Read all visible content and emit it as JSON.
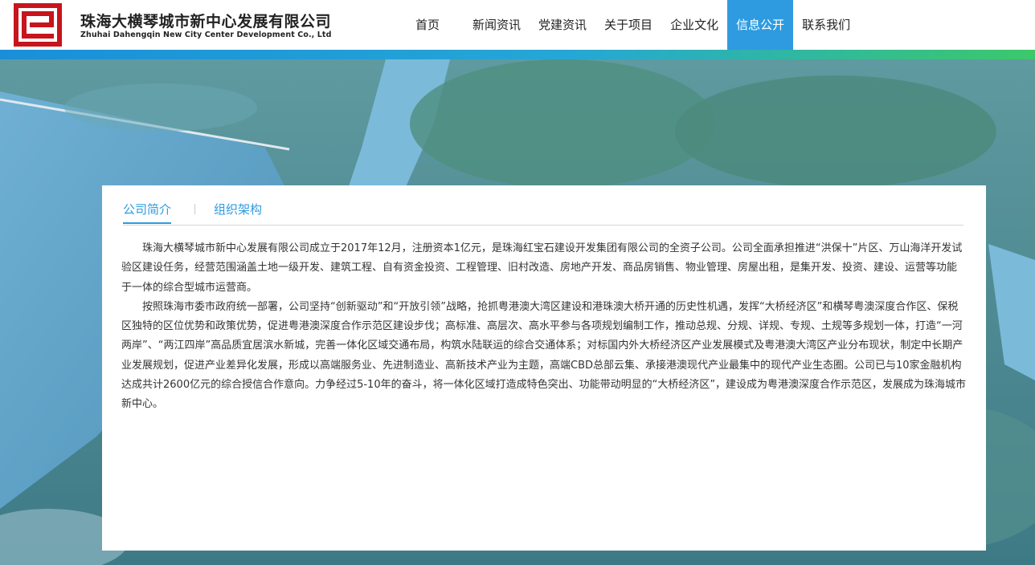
{
  "company": {
    "name_cn": "珠海大横琴城市新中心发展有限公司",
    "name_en": "Zhuhai Dahengqin New City Center Development Co., Ltd",
    "brand_color": "#c8141c"
  },
  "nav": {
    "items": [
      {
        "label": "首页"
      },
      {
        "label": "新闻资讯"
      },
      {
        "label": "党建资讯"
      },
      {
        "label": "关于项目"
      },
      {
        "label": "企业文化"
      },
      {
        "label": "信息公开",
        "active": true
      },
      {
        "label": "联系我们"
      }
    ],
    "active_color": "#2e9be0"
  },
  "tabs": [
    {
      "label": "公司简介",
      "active": true
    },
    {
      "label": "组织架构",
      "active": false
    }
  ],
  "article": {
    "paragraphs": [
      "珠海大横琴城市新中心发展有限公司成立于2017年12月，注册资本1亿元，是珠海红宝石建设开发集团有限公司的全资子公司。公司全面承担推进“洪保十”片区、万山海洋开发试验区建设任务，经营范围涵盖土地一级开发、建筑工程、自有资金投资、工程管理、旧村改造、房地产开发、商品房销售、物业管理、房屋出租，是集开发、投资、建设、运营等功能于一体的综合型城市运营商。",
      "按照珠海市委市政府统一部署，公司坚持“创新驱动”和“开放引领”战略，抢抓粤港澳大湾区建设和港珠澳大桥开通的历史性机遇，发挥“大桥经济区”和横琴粤澳深度合作区、保税区独特的区位优势和政策优势，促进粤港澳深度合作示范区建设步伐；高标准、高层次、高水平参与各项规划编制工作，推动总规、分规、详规、专规、土规等多规划一体，打造“一河两岸”、“两江四岸”高品质宜居滨水新城，完善一体化区域交通布局，构筑水陆联运的综合交通体系；对标国内外大桥经济区产业发展模式及粤港澳大湾区产业分布现状，制定中长期产业发展规划，促进产业差异化发展，形成以高端服务业、先进制造业、高新技术产业为主题，高端CBD总部云集、承接港澳现代产业最集中的现代产业生态圈。公司已与10家金融机构达成共计2600亿元的综合授信合作意向。力争经过5-10年的奋斗，将一体化区域打造成特色突出、功能带动明显的“大桥经济区”，建设成为粤港澳深度合作示范区，发展成为珠海城市新中心。"
    ]
  },
  "hero": {
    "image": "aerial-city-view"
  }
}
